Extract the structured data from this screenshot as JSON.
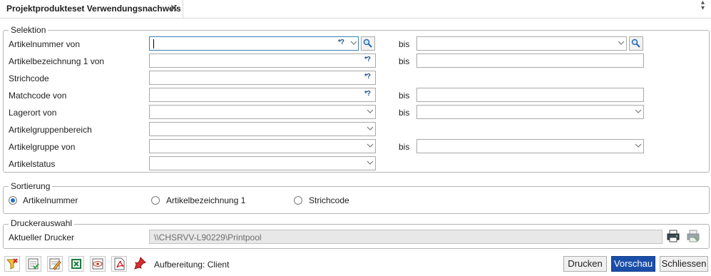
{
  "tab": {
    "title": "Projektprodukteset Verwendungsnachweis",
    "close": "✕"
  },
  "selektion": {
    "legend": "Selektion",
    "bis": "bis",
    "rows": [
      {
        "label": "Artikelnummer von"
      },
      {
        "label": "Artikelbezeichnung 1 von"
      },
      {
        "label": "Strichcode"
      },
      {
        "label": "Matchcode von"
      },
      {
        "label": "Lagerort von"
      },
      {
        "label": "Artikelgruppenbereich"
      },
      {
        "label": "Artikelgruppe von"
      },
      {
        "label": "Artikelstatus"
      }
    ],
    "wildcard": "*?"
  },
  "sortierung": {
    "legend": "Sortierung",
    "options": [
      "Artikelnummer",
      "Artikelbezeichnung 1",
      "Strichcode"
    ],
    "selected": "Artikelnummer"
  },
  "drucker": {
    "legend": "Druckerauswahl",
    "label": "Aktueller Drucker",
    "value": "\\\\CHSRVV-L90229\\Printpool"
  },
  "footer": {
    "aufbereitung": "Aufbereitung: Client",
    "drucken": "Drucken",
    "vorschau": "Vorschau",
    "schliessen": "Schliessen"
  },
  "icons": {
    "toolbar": [
      "filter-reset-icon",
      "checklist-icon",
      "edit-list-icon",
      "excel-export-icon",
      "preview-eye-icon",
      "pdf-export-icon",
      "pin-icon"
    ],
    "printer": [
      "printer-settings-icon",
      "printer-disabled-icon"
    ]
  },
  "colors": {
    "primary_button": "#1a4ea8",
    "radio_selected": "#1d6fd1",
    "wildcard": "#1f4e8c"
  }
}
